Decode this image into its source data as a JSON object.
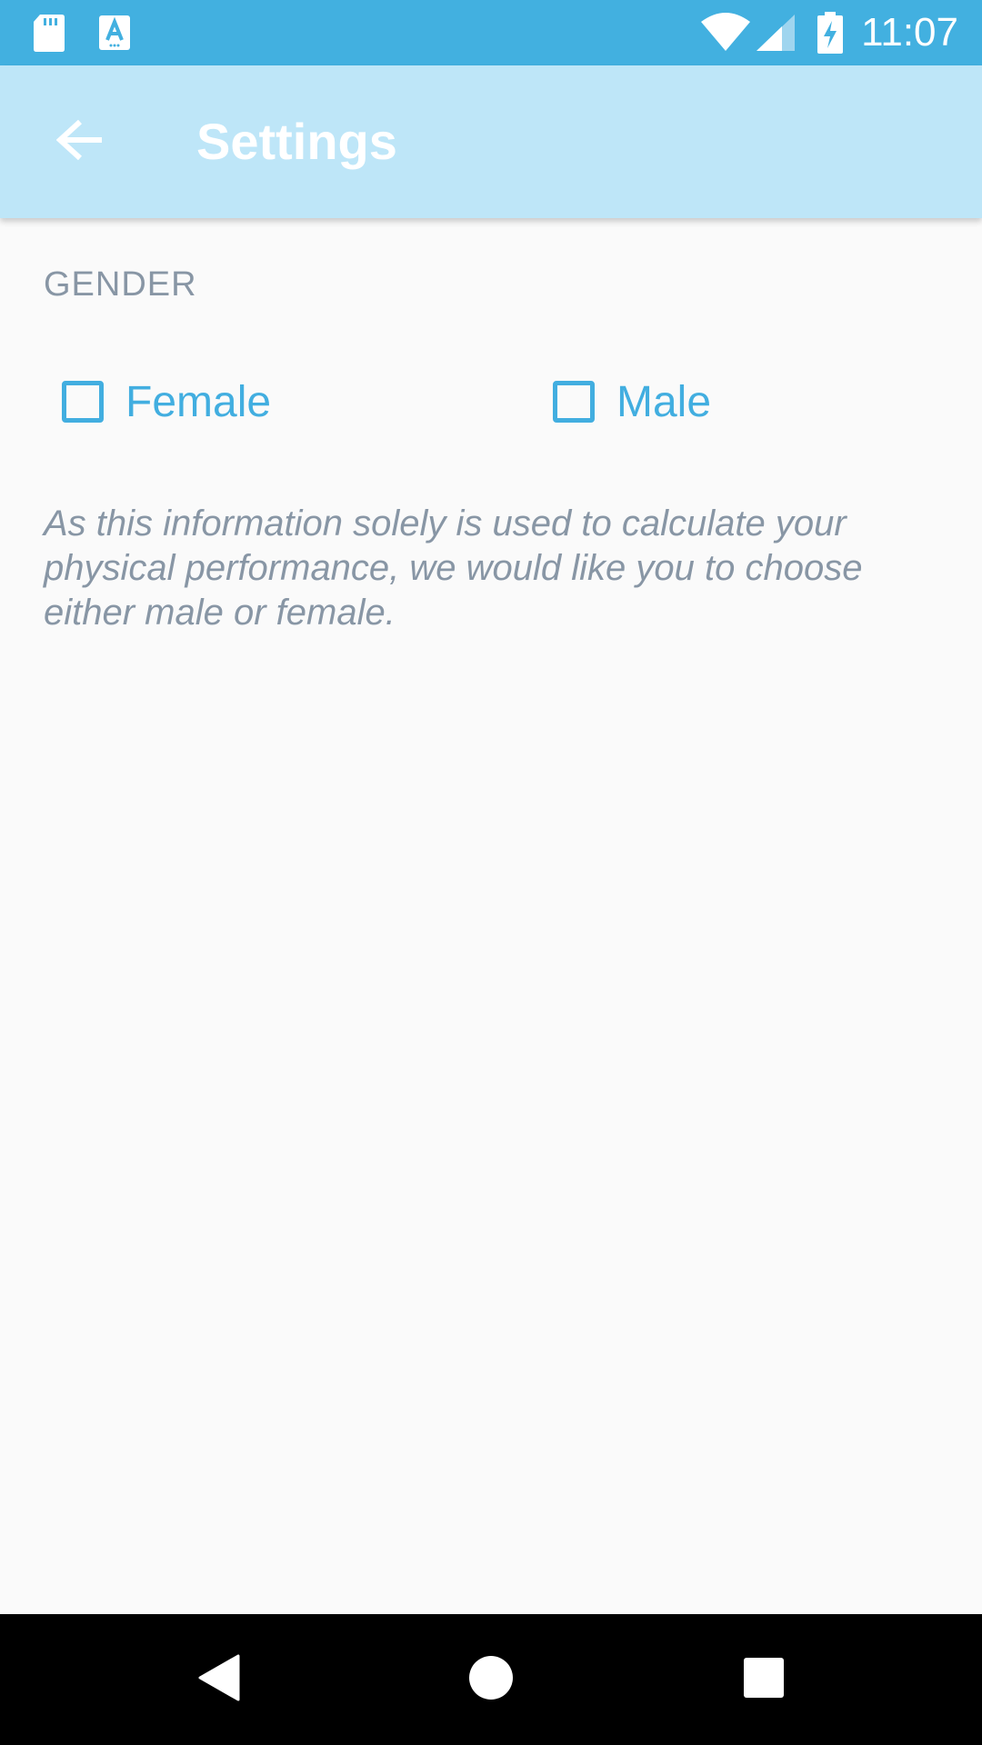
{
  "status_bar": {
    "time": "11:07",
    "background": "#42b0e0",
    "icons": [
      "sd-card-icon",
      "keyboard-a-icon",
      "wifi-icon",
      "cellular-signal-icon",
      "battery-charging-icon"
    ]
  },
  "app_bar": {
    "title": "Settings",
    "back_icon": "arrow-left-icon",
    "background": "#bee6f8"
  },
  "gender_section": {
    "header": "GENDER",
    "options": [
      {
        "label": "Female",
        "checked": false
      },
      {
        "label": "Male",
        "checked": false
      }
    ],
    "note": "As this information solely is used to calculate your physical performance, we would like you to choose either male or female."
  },
  "nav_bar": {
    "buttons": [
      "back-triangle-icon",
      "home-circle-icon",
      "recents-square-icon"
    ]
  },
  "colors": {
    "accent": "#42aee0",
    "secondary_text": "#8896a5",
    "background": "#fafafa"
  }
}
